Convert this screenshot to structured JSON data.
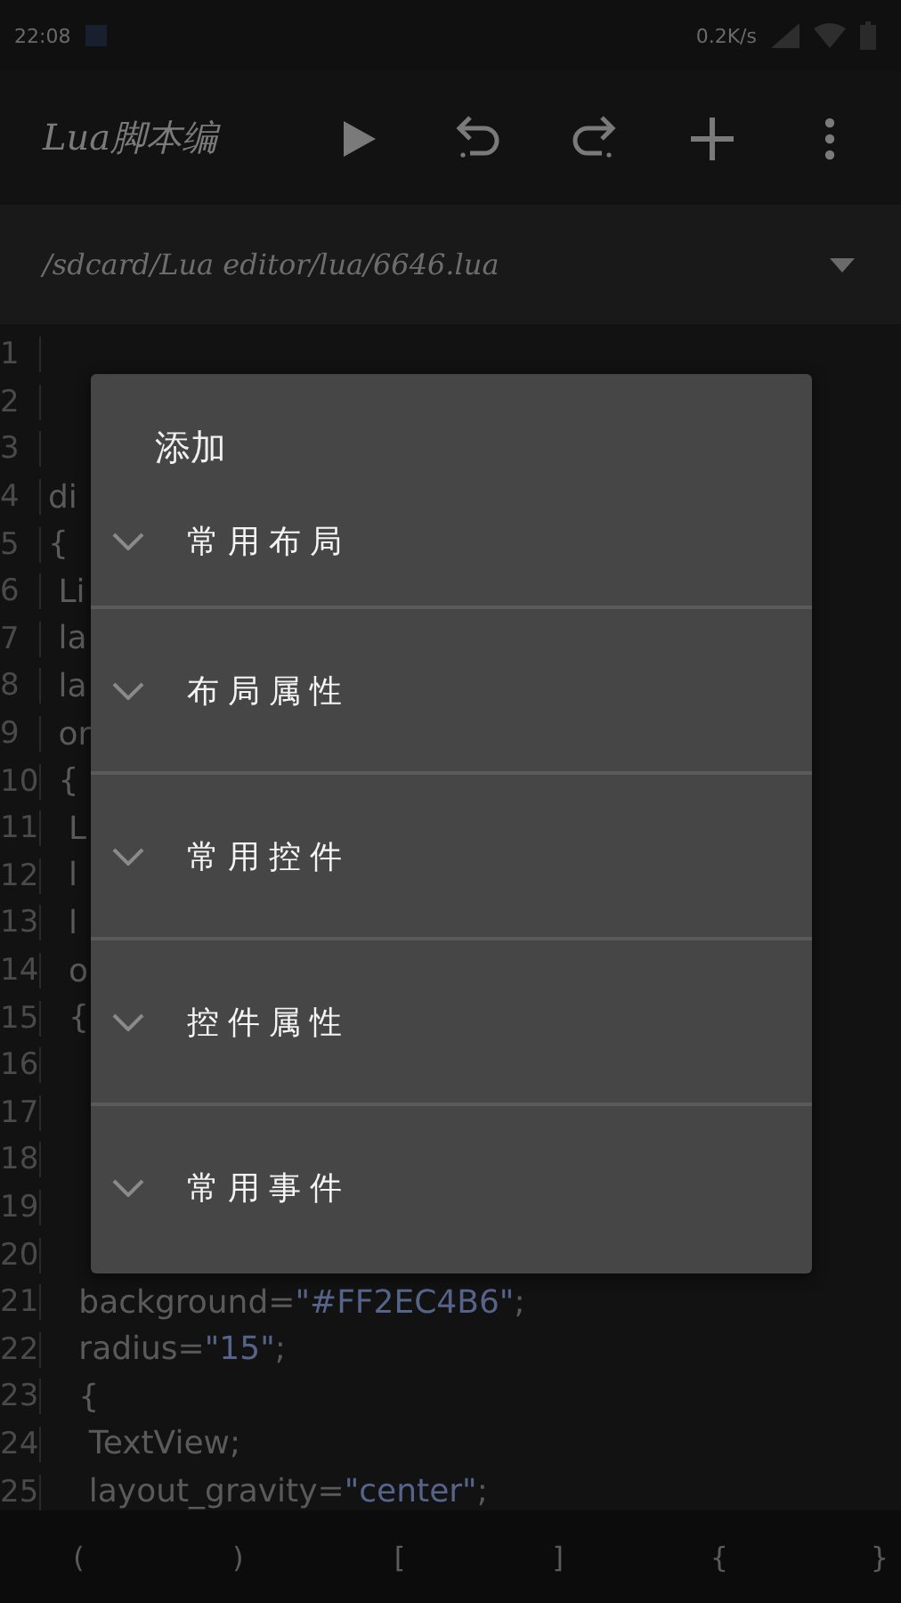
{
  "status_bar": {
    "time": "22:08",
    "speed": "0.2K/s"
  },
  "toolbar": {
    "title": "Lua脚本编"
  },
  "path_bar": {
    "path": "/sdcard/Lua editor/lua/6646.lua"
  },
  "editor": {
    "lines": [
      {
        "number": "1"
      },
      {
        "number": "2"
      },
      {
        "number": "3"
      },
      {
        "number": "4",
        "parts": [
          {
            "text": "di",
            "kind": "plain"
          }
        ]
      },
      {
        "number": "5",
        "parts": [
          {
            "text": "{",
            "kind": "plain"
          }
        ]
      },
      {
        "number": "6",
        "parts": [
          {
            "text": " Li",
            "kind": "plain"
          }
        ]
      },
      {
        "number": "7",
        "parts": [
          {
            "text": " la",
            "kind": "plain"
          }
        ]
      },
      {
        "number": "8",
        "parts": [
          {
            "text": " la",
            "kind": "plain"
          }
        ]
      },
      {
        "number": "9",
        "parts": [
          {
            "text": " or",
            "kind": "plain"
          }
        ]
      },
      {
        "number": "10",
        "parts": [
          {
            "text": " {",
            "kind": "plain"
          }
        ]
      },
      {
        "number": "11",
        "parts": [
          {
            "text": "  L",
            "kind": "plain"
          }
        ]
      },
      {
        "number": "12",
        "parts": [
          {
            "text": "  l",
            "kind": "plain"
          }
        ]
      },
      {
        "number": "13",
        "parts": [
          {
            "text": "  l",
            "kind": "plain"
          }
        ]
      },
      {
        "number": "14",
        "parts": [
          {
            "text": "  o",
            "kind": "plain"
          }
        ]
      },
      {
        "number": "15",
        "parts": [
          {
            "text": "  {",
            "kind": "plain"
          }
        ]
      },
      {
        "number": "16"
      },
      {
        "number": "17"
      },
      {
        "number": "18"
      },
      {
        "number": "19"
      },
      {
        "number": "20"
      },
      {
        "number": "21",
        "parts": [
          {
            "text": "   background=",
            "kind": "plain"
          },
          {
            "text": "\"#FF2EC4B6\"",
            "kind": "string"
          },
          {
            "text": ";",
            "kind": "plain"
          }
        ]
      },
      {
        "number": "22",
        "parts": [
          {
            "text": "   radius=",
            "kind": "plain"
          },
          {
            "text": "\"15\"",
            "kind": "string"
          },
          {
            "text": ";",
            "kind": "plain"
          }
        ]
      },
      {
        "number": "23",
        "parts": [
          {
            "text": "   {",
            "kind": "plain"
          }
        ]
      },
      {
        "number": "24",
        "parts": [
          {
            "text": "    TextView;",
            "kind": "plain"
          }
        ]
      },
      {
        "number": "25",
        "parts": [
          {
            "text": "    layout_gravity=",
            "kind": "plain"
          },
          {
            "text": "\"center\"",
            "kind": "string"
          },
          {
            "text": ";",
            "kind": "plain"
          }
        ]
      }
    ]
  },
  "symbol_bar": {
    "keys": [
      "(",
      ")",
      "[",
      "]",
      "{",
      "}"
    ]
  },
  "dialog": {
    "title": "添加",
    "items": [
      {
        "label": "常用布局",
        "expanded": false
      },
      {
        "label": "布局属性",
        "expanded": false
      },
      {
        "label": "常用控件",
        "expanded": false
      },
      {
        "label": "控件属性",
        "expanded": false
      },
      {
        "label": "常用事件",
        "expanded": false
      }
    ]
  }
}
